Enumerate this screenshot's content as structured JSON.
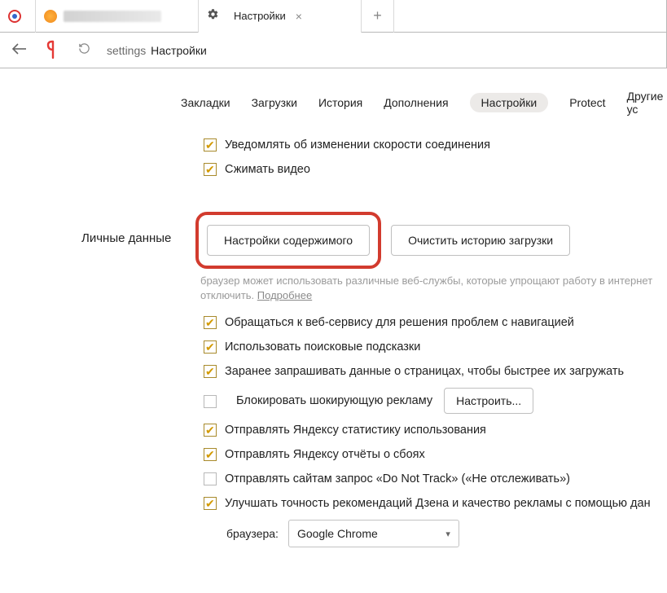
{
  "tabs": {
    "settings_title": "Настройки"
  },
  "toolbar": {
    "addr_prefix": "settings",
    "addr_label": "Настройки"
  },
  "nav": {
    "bookmarks": "Закладки",
    "downloads": "Загрузки",
    "history": "История",
    "addons": "Дополнения",
    "settings": "Настройки",
    "protect": "Protect",
    "other": "Другие ус"
  },
  "top_checks": {
    "notify_speed": "Уведомлять об изменении скорости соединения",
    "compress_video": "Сжимать видео"
  },
  "section": {
    "personal_data": "Личные данные"
  },
  "buttons": {
    "content_settings": "Настройки содержимого",
    "clear_history": "Очистить историю загрузки",
    "configure": "Настроить..."
  },
  "helper": {
    "text_a": "браузер может использовать различные веб-службы, которые упрощают работу в интернет",
    "text_b": "отключить.",
    "more": "Подробнее"
  },
  "checks": {
    "nav_help": "Обращаться к веб-сервису для решения проблем с навигацией",
    "search_hints": "Использовать поисковые подсказки",
    "prefetch": "Заранее запрашивать данные о страницах, чтобы быстрее их загружать",
    "block_ads": "Блокировать шокирующую рекламу",
    "usage_stats": "Отправлять Яндексу статистику использования",
    "crash_reports": "Отправлять Яндексу отчёты о сбоях",
    "dnt": "Отправлять сайтам запрос «Do Not Track» («Не отслеживать»)",
    "zen_quality": "Улучшать точность рекомендаций Дзена и качество рекламы с помощью дан"
  },
  "browser_row": {
    "label": "браузера:",
    "selected": "Google Chrome"
  }
}
